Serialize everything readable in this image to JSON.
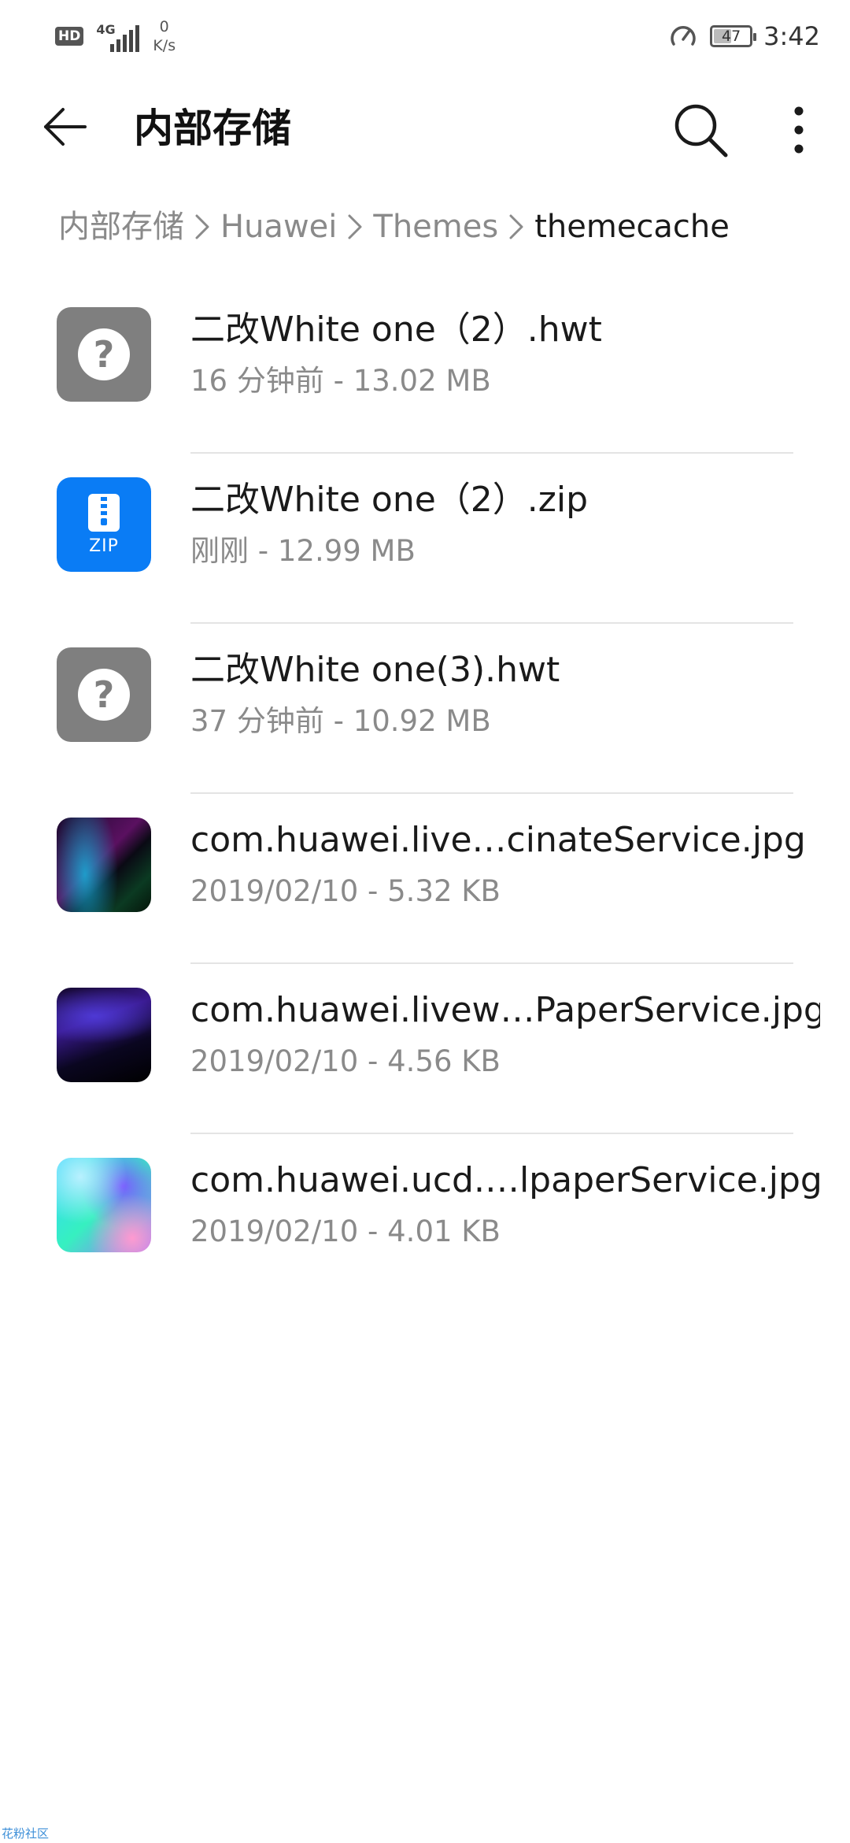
{
  "status_bar": {
    "hd_label": "HD",
    "network_type": "4G",
    "speed_value": "0",
    "speed_unit": "K/s",
    "battery_level": "47",
    "time": "3:42"
  },
  "toolbar": {
    "title": "内部存储"
  },
  "breadcrumb": [
    "内部存储",
    "Huawei",
    "Themes",
    "themecache"
  ],
  "files": [
    {
      "name": "二改White one（2）.hwt",
      "time": "16 分钟前",
      "size": "13.02 MB",
      "type": "unknown"
    },
    {
      "name": "二改White one（2）.zip",
      "time": "刚刚",
      "size": "12.99 MB",
      "type": "zip",
      "badge": "ZIP"
    },
    {
      "name": "二改White one(3).hwt",
      "time": "37 分钟前",
      "size": "10.92 MB",
      "type": "unknown"
    },
    {
      "name": "com.huawei.live…cinateService.jpg",
      "time": "2019/02/10",
      "size": "5.32 KB",
      "type": "image"
    },
    {
      "name": "com.huawei.livew…PaperService.jpg",
      "time": "2019/02/10",
      "size": "4.56 KB",
      "type": "image"
    },
    {
      "name": "com.huawei.ucd.…lpaperService.jpg",
      "time": "2019/02/10",
      "size": "4.01 KB",
      "type": "image"
    }
  ],
  "meta_separator": " - ",
  "watermark": "花粉社区",
  "colors": {
    "accent_blue": "#0a7cf5",
    "unknown_gray": "#7f7f7f",
    "secondary_text": "#8a8a8a"
  }
}
